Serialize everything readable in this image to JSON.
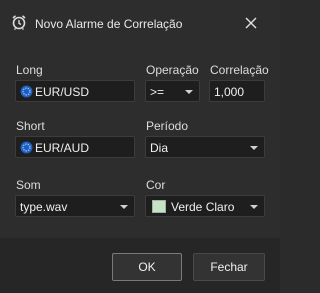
{
  "window": {
    "title": "Novo Alarme de Correlação",
    "icon": "alarm-clock-icon",
    "close_icon": "close-icon"
  },
  "form": {
    "long": {
      "label": "Long",
      "value": "EUR/USD",
      "icon": "coin-icon"
    },
    "operation": {
      "label": "Operação",
      "value": ">="
    },
    "correlation": {
      "label": "Correlação",
      "value": "1,000"
    },
    "short": {
      "label": "Short",
      "value": "EUR/AUD",
      "icon": "coin-icon"
    },
    "period": {
      "label": "Período",
      "value": "Dia"
    },
    "sound": {
      "label": "Som",
      "value": "type.wav"
    },
    "color": {
      "label": "Cor",
      "value": "Verde Claro",
      "swatch": "#c7e3c7"
    }
  },
  "buttons": {
    "ok": "OK",
    "cancel": "Fechar"
  }
}
